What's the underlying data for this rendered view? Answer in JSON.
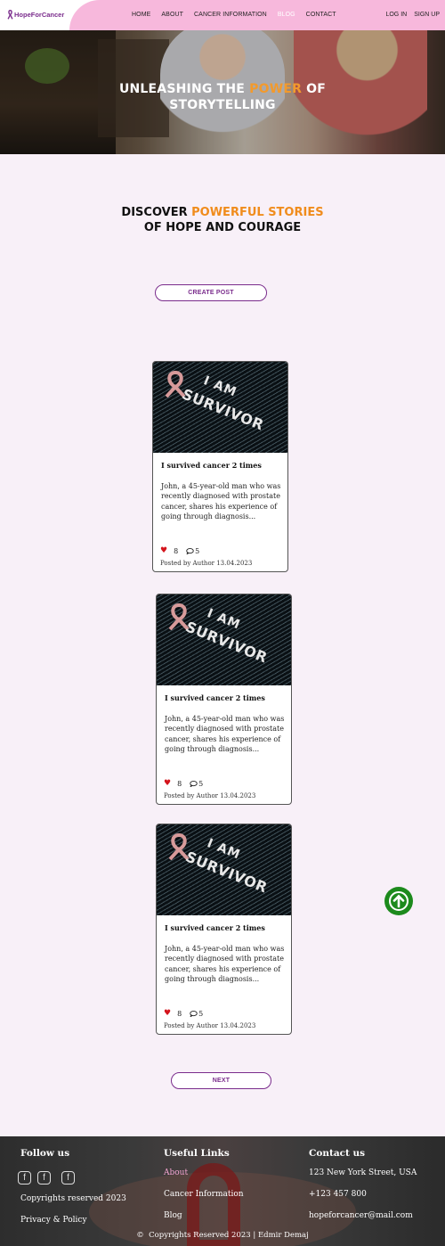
{
  "brand": {
    "name": "HopeForCancer",
    "color": "#7a2c8c",
    "accent": "#f39a2c"
  },
  "nav": {
    "items": [
      {
        "label": "HOME"
      },
      {
        "label": "ABOUT"
      },
      {
        "label": "CANCER INFORMATION"
      },
      {
        "label": "BLOG",
        "active": true
      },
      {
        "label": "CONTACT"
      }
    ],
    "login": "LOG IN",
    "signup": "SIGN UP"
  },
  "hero": {
    "title_pre": "UNLEASHING THE ",
    "title_highlight": "POWER",
    "title_post": " OF",
    "title_line2": "STORYTELLING"
  },
  "discover": {
    "line1_pre": "DISCOVER ",
    "line1_highlight": "POWERFUL STORIES",
    "line2": "OF HOPE AND COURAGE"
  },
  "create_post": "CREATE POST",
  "posts": [
    {
      "image_line1": "I AM",
      "image_line2": "SURVIVOR",
      "title": "I survived cancer 2 times",
      "excerpt": "John, a 45-year-old man who was recently diagnosed with prostate cancer, shares his experience of going through diagnosis...",
      "likes": "8",
      "comments": "5",
      "meta": "Posted by Author 13.04.2023"
    },
    {
      "image_line1": "I AM",
      "image_line2": "SURVIVOR",
      "title": "I survived cancer 2 times",
      "excerpt": "John, a 45-year-old man who was recently diagnosed with prostate cancer, shares his experience of going through diagnosis...",
      "likes": "8",
      "comments": "5",
      "meta": "Posted by Author 13.04.2023"
    },
    {
      "image_line1": "I AM",
      "image_line2": "SURVIVOR",
      "title": "I survived cancer 2 times",
      "excerpt": "John, a 45-year-old man who was recently diagnosed with prostate cancer, shares his experience of going through diagnosis...",
      "likes": "8",
      "comments": "5",
      "meta": "Posted by Author 13.04.2023"
    }
  ],
  "next": "NEXT",
  "footer": {
    "follow": {
      "heading": "Follow us",
      "icons": [
        "facebook-icon",
        "facebook-icon",
        "facebook-icon"
      ],
      "copyrights": "Copyrights reserved 2023",
      "privacy": "Privacy & Policy"
    },
    "links": {
      "heading": "Useful Links",
      "items": [
        "About",
        "Cancer Information",
        "Blog"
      ]
    },
    "contact": {
      "heading": "Contact us",
      "address": "123 New York Street, USA",
      "phone": "+123 457 800",
      "email": "hopeforcancer@mail.com"
    },
    "copyright": "Copyrights Reserved 2023 | Edmir Demaj"
  }
}
